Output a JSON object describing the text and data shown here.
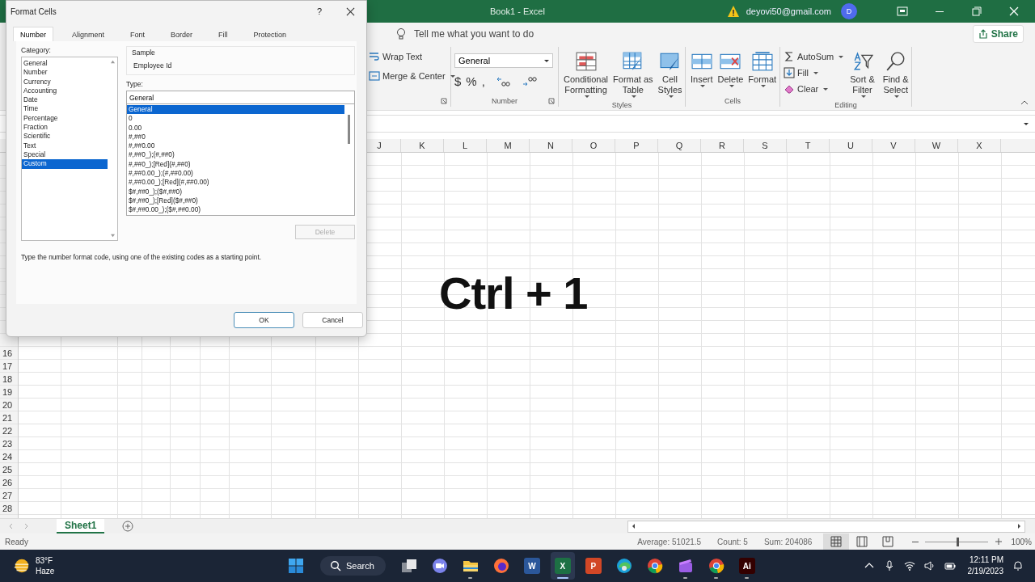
{
  "window": {
    "title": "Book1  -  Excel",
    "account": "deyovi50@gmail.com",
    "avatar": "D"
  },
  "tell_me": {
    "placeholder": "Tell me what you want to do"
  },
  "share_button": "Share",
  "ribbon": {
    "alignment": [
      {
        "kind": "wrap",
        "label": "Wrap Text"
      },
      {
        "kind": "merge",
        "label": "Merge & Center",
        "dropdown": true
      }
    ],
    "number": {
      "format": "General",
      "symbols": [
        "$",
        "%",
        ","
      ],
      "label": "Number"
    },
    "styles": {
      "label": "Styles",
      "buttons": [
        {
          "kind": "conditional",
          "lines": [
            "Conditional",
            "Formatting"
          ],
          "dropdown": true
        },
        {
          "kind": "table",
          "lines": [
            "Format as",
            "Table"
          ],
          "dropdown": true
        },
        {
          "kind": "cellstyles",
          "lines": [
            "Cell",
            "Styles"
          ],
          "dropdown": true
        }
      ]
    },
    "cells": {
      "label": "Cells",
      "buttons": [
        {
          "kind": "insert",
          "lines": [
            "Insert"
          ],
          "dropdown": true
        },
        {
          "kind": "delete",
          "lines": [
            "Delete"
          ],
          "dropdown": true
        },
        {
          "kind": "format",
          "lines": [
            "Format"
          ],
          "dropdown": true
        }
      ]
    },
    "editing": {
      "label": "Editing",
      "small": [
        {
          "kind": "sum",
          "label": "AutoSum",
          "dropdown": true
        },
        {
          "kind": "fill",
          "label": "Fill",
          "dropdown": true
        },
        {
          "kind": "clear",
          "label": "Clear",
          "dropdown": true
        }
      ],
      "buttons": [
        {
          "kind": "sort",
          "lines": [
            "Sort &",
            "Filter"
          ],
          "dropdown": true
        },
        {
          "kind": "find",
          "lines": [
            "Find &",
            "Select"
          ],
          "dropdown": true
        }
      ]
    }
  },
  "columns": [
    "J",
    "K",
    "L",
    "M",
    "N",
    "O",
    "P",
    "Q",
    "R",
    "S",
    "T",
    "U",
    "V",
    "W",
    "X"
  ],
  "rows": [
    "16",
    "17",
    "18",
    "19",
    "20",
    "21",
    "22",
    "23",
    "24",
    "25",
    "26",
    "27",
    "28"
  ],
  "sheet_tabs": [
    {
      "label": "Sheet1",
      "selected": true
    }
  ],
  "status_bar": {
    "mode": "Ready",
    "average": "Average: 51021.5",
    "count": "Count: 5",
    "sum": "Sum: 204086",
    "views": [
      {
        "kind": "normal",
        "selected": true
      },
      {
        "kind": "layout",
        "selected": false
      },
      {
        "kind": "pagebreak",
        "selected": false
      }
    ],
    "zoom": {
      "level": 0.52,
      "reading": "100%"
    }
  },
  "overlay_caption": "Ctrl + 1",
  "dialog": {
    "title": "Format Cells",
    "help": "?",
    "tabs": [
      {
        "label": "Number",
        "selected": true
      },
      {
        "label": "Alignment",
        "selected": false
      },
      {
        "label": "Font",
        "selected": false
      },
      {
        "label": "Border",
        "selected": false
      },
      {
        "label": "Fill",
        "selected": false
      },
      {
        "label": "Protection",
        "selected": false
      }
    ],
    "category_label": "Category:",
    "categories": [
      {
        "label": "General",
        "selected": false
      },
      {
        "label": "Number",
        "selected": false
      },
      {
        "label": "Currency",
        "selected": false
      },
      {
        "label": "Accounting",
        "selected": false
      },
      {
        "label": "Date",
        "selected": false
      },
      {
        "label": "Time",
        "selected": false
      },
      {
        "label": "Percentage",
        "selected": false
      },
      {
        "label": "Fraction",
        "selected": false
      },
      {
        "label": "Scientific",
        "selected": false
      },
      {
        "label": "Text",
        "selected": false
      },
      {
        "label": "Special",
        "selected": false
      },
      {
        "label": "Custom",
        "selected": true
      }
    ],
    "sample_label": "Sample",
    "sample": "Employee Id",
    "type_label": "Type:",
    "type_value": "General",
    "types": [
      {
        "label": "General",
        "selected": true
      },
      {
        "label": "0",
        "selected": false
      },
      {
        "label": "0.00",
        "selected": false
      },
      {
        "label": "#,##0",
        "selected": false
      },
      {
        "label": "#,##0.00",
        "selected": false
      },
      {
        "label": "#,##0_);(#,##0)",
        "selected": false
      },
      {
        "label": "#,##0_);[Red](#,##0)",
        "selected": false
      },
      {
        "label": "#,##0.00_);(#,##0.00)",
        "selected": false
      },
      {
        "label": "#,##0.00_);[Red](#,##0.00)",
        "selected": false
      },
      {
        "label": "$#,##0_);($#,##0)",
        "selected": false
      },
      {
        "label": "$#,##0_);[Red]($#,##0)",
        "selected": false
      },
      {
        "label": "$#,##0.00_);($#,##0.00)",
        "selected": false
      }
    ],
    "delete_button": {
      "label": "Delete",
      "disabled": true
    },
    "description": "Type the number format code, using one of the existing codes as a starting point.",
    "buttons": [
      {
        "label": "OK",
        "default": true
      },
      {
        "label": "Cancel",
        "default": false
      }
    ]
  },
  "taskbar": {
    "temperature": "83°F",
    "condition": "Haze",
    "search": "Search",
    "apps": [
      {
        "kind": "taskview",
        "running": false,
        "selected": false
      },
      {
        "kind": "chat",
        "running": false,
        "selected": false
      },
      {
        "kind": "explorer",
        "running": true,
        "selected": false
      },
      {
        "kind": "firefox",
        "running": false,
        "selected": false
      },
      {
        "kind": "word",
        "glyph": "W",
        "running": false,
        "selected": false
      },
      {
        "kind": "excel",
        "glyph": "X",
        "running": true,
        "selected": true
      },
      {
        "kind": "powerpoint",
        "glyph": "P",
        "running": false,
        "selected": false
      },
      {
        "kind": "edge",
        "running": false,
        "selected": false
      },
      {
        "kind": "chrome",
        "running": false,
        "selected": false
      },
      {
        "kind": "clipchamp",
        "running": true,
        "selected": false
      },
      {
        "kind": "chrome",
        "running": true,
        "selected": false
      },
      {
        "kind": "illustrator",
        "glyph": "Ai",
        "running": true,
        "selected": false
      }
    ],
    "time": "12:11 PM",
    "date": "2/19/2023"
  }
}
